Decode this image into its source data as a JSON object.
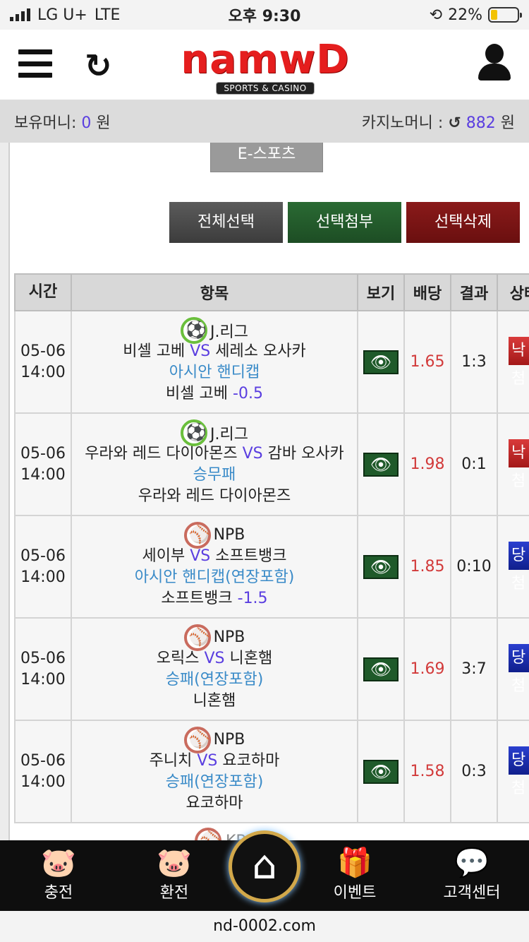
{
  "status_bar": {
    "carrier": "LG U+",
    "network": "LTE",
    "time": "오후 9:30",
    "battery": "22%"
  },
  "header": {
    "logo_text": "namwD",
    "logo_sub": "SPORTS & CASINO"
  },
  "money": {
    "holding_label": "보유머니:",
    "holding_value": "0",
    "holding_unit": "원",
    "casino_label": "카지노머니 :",
    "casino_value": "882",
    "casino_unit": "원"
  },
  "tab_label": "E-스포츠",
  "actions": {
    "select_all": "전체선택",
    "attach": "선택첨부",
    "delete": "선택삭제"
  },
  "columns": [
    "시간",
    "항목",
    "보기",
    "배당",
    "결과",
    "상태"
  ],
  "rows": [
    {
      "date": "05-06",
      "time": "14:00",
      "sport": "soccer",
      "league": "J.리그",
      "home": "비셀 고베",
      "vs": "VS",
      "away": "세레소 오사카",
      "market": "아시안 핸디캡",
      "pick": "비셀 고베",
      "handicap": "-0.5",
      "odds": "1.65",
      "result": "1:3",
      "status": "낙첨",
      "status_type": "lose"
    },
    {
      "date": "05-06",
      "time": "14:00",
      "sport": "soccer",
      "league": "J.리그",
      "home": "우라와 레드 다이아몬즈",
      "vs": "VS",
      "away": "감바 오사카",
      "market": "승무패",
      "pick": "우라와 레드 다이아몬즈",
      "handicap": "",
      "odds": "1.98",
      "result": "0:1",
      "status": "낙첨",
      "status_type": "lose"
    },
    {
      "date": "05-06",
      "time": "14:00",
      "sport": "baseball",
      "league": "NPB",
      "home": "세이부",
      "vs": "VS",
      "away": "소프트뱅크",
      "market": "아시안 핸디캡(연장포함)",
      "pick": "소프트뱅크",
      "handicap": "-1.5",
      "odds": "1.85",
      "result": "0:10",
      "status": "당첨",
      "status_type": "win"
    },
    {
      "date": "05-06",
      "time": "14:00",
      "sport": "baseball",
      "league": "NPB",
      "home": "오릭스",
      "vs": "VS",
      "away": "니혼햄",
      "market": "승패(연장포함)",
      "pick": "니혼햄",
      "handicap": "",
      "odds": "1.69",
      "result": "3:7",
      "status": "당첨",
      "status_type": "win"
    },
    {
      "date": "05-06",
      "time": "14:00",
      "sport": "baseball",
      "league": "NPB",
      "home": "주니치",
      "vs": "VS",
      "away": "요코하마",
      "market": "승패(연장포함)",
      "pick": "요코하마",
      "handicap": "",
      "odds": "1.58",
      "result": "0:3",
      "status": "당첨",
      "status_type": "win"
    }
  ],
  "next_row_peek": "KBO",
  "bottom_nav": {
    "charge": "충전",
    "exchange": "환전",
    "event": "이벤트",
    "support": "고객센터"
  },
  "url": "nd-0002.com"
}
